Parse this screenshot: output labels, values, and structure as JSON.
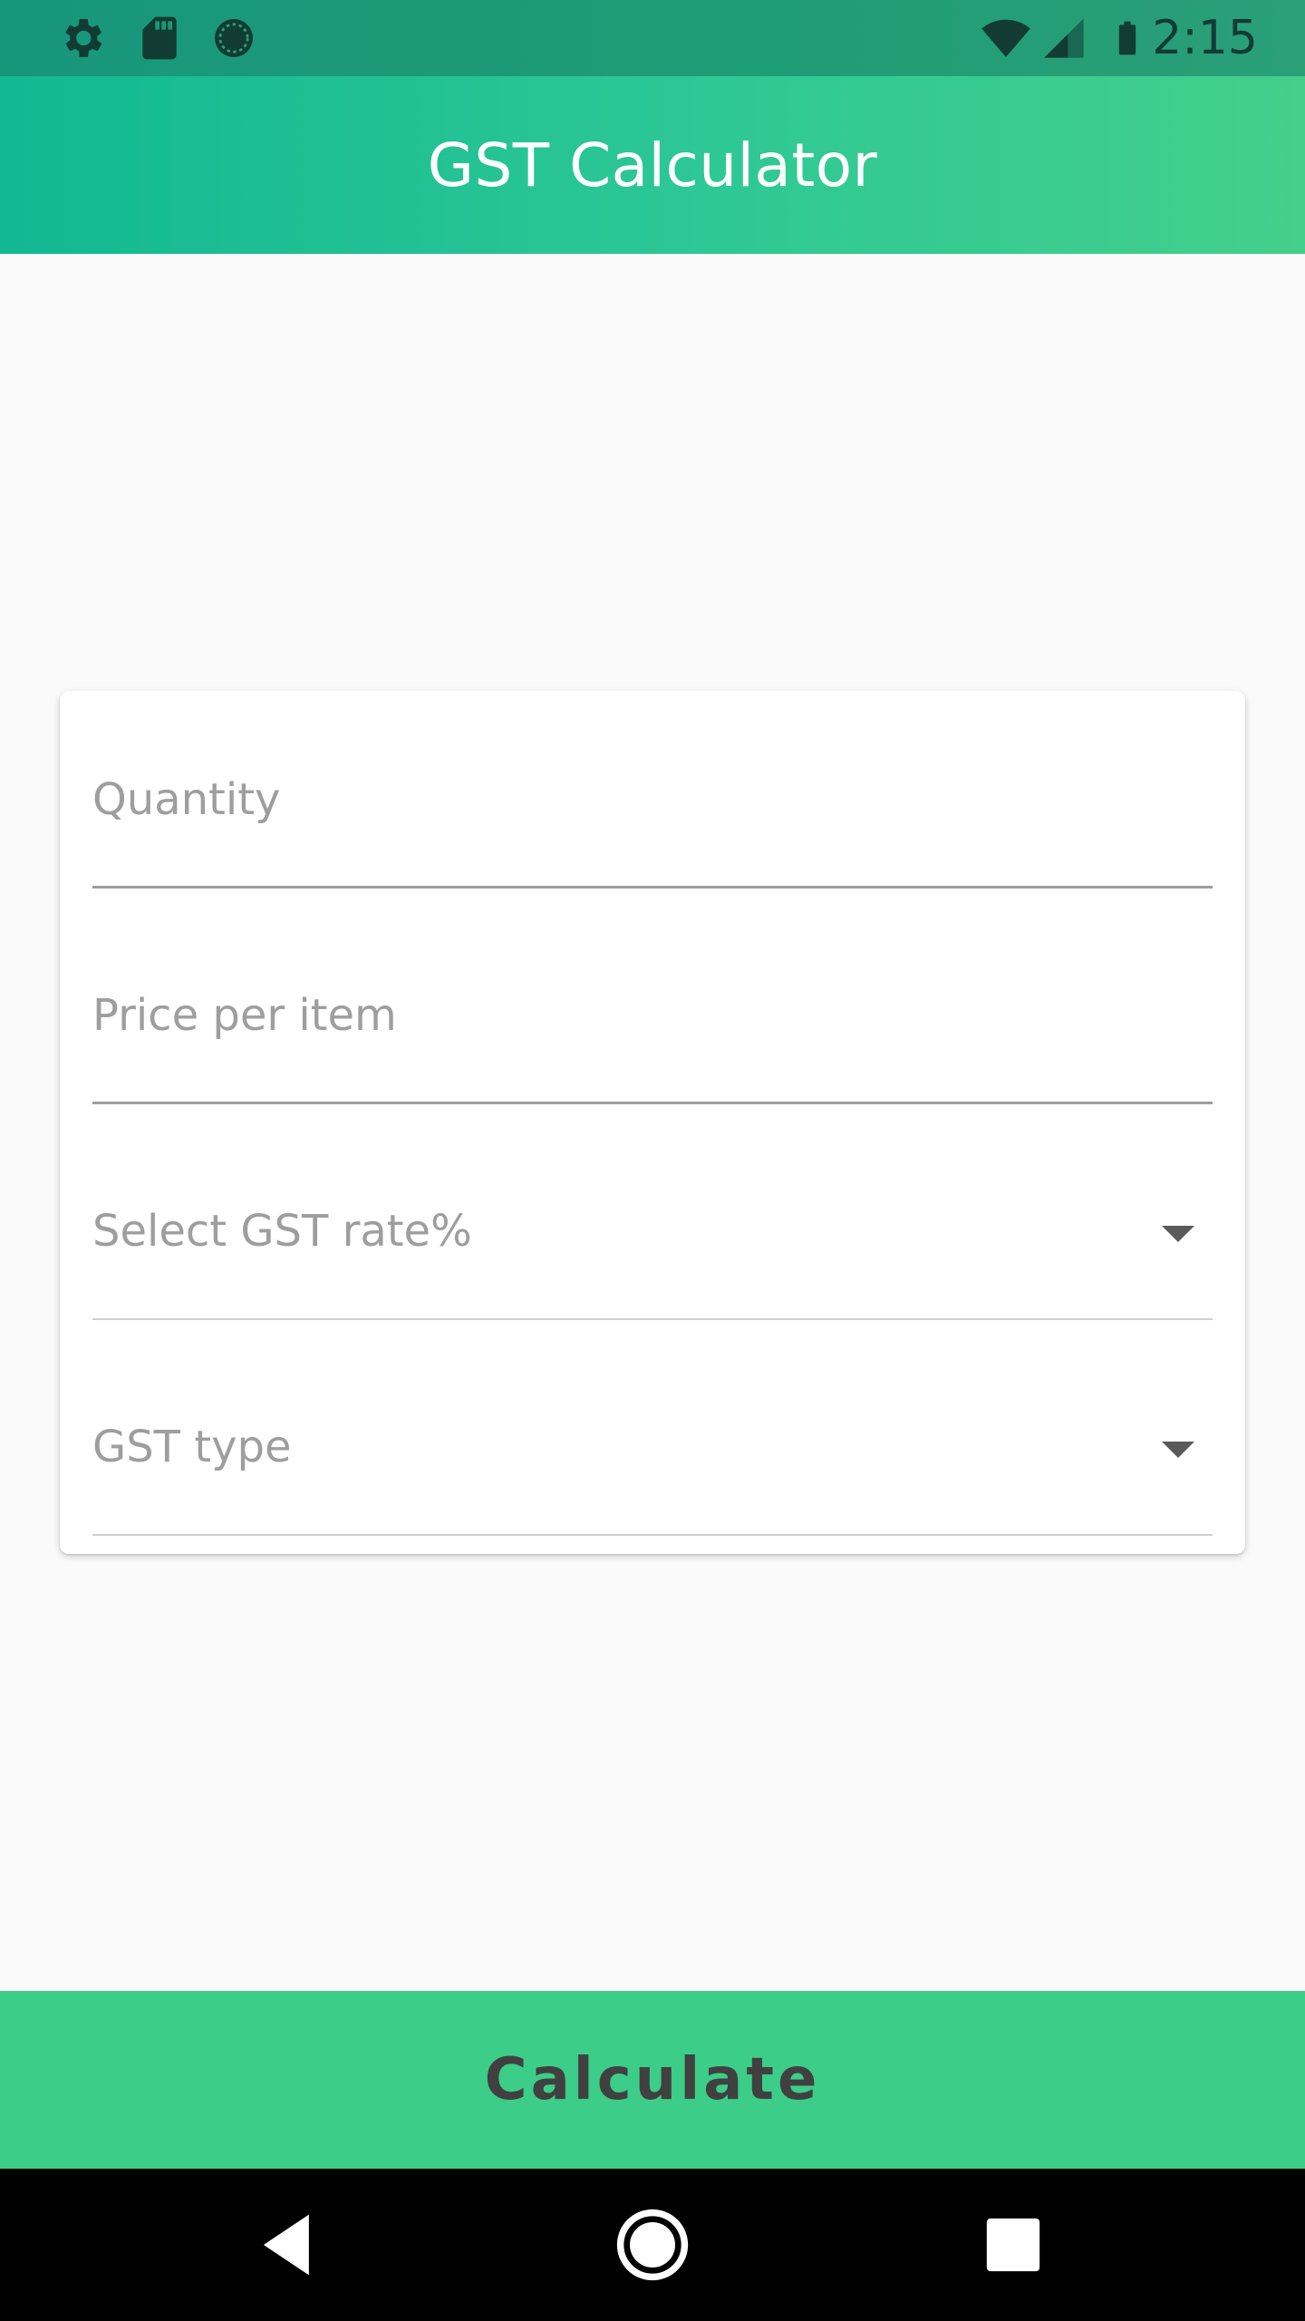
{
  "status_bar": {
    "time": "2:15",
    "left_icons": [
      "gear-icon",
      "sd-card-icon",
      "sync-icon"
    ],
    "right_icons": [
      "wifi-icon",
      "cell-signal-icon",
      "battery-icon"
    ]
  },
  "app_bar": {
    "title": "GST Calculator"
  },
  "form": {
    "quantity": {
      "label": "Quantity",
      "value": ""
    },
    "price": {
      "label": "Price per item",
      "value": ""
    },
    "gst_rate": {
      "label": "Select GST rate%",
      "value": ""
    },
    "gst_type": {
      "label": "GST type",
      "value": ""
    }
  },
  "actions": {
    "calculate_label": "Calculate"
  },
  "nav_bar": {
    "buttons": [
      "back-icon",
      "home-icon",
      "recents-icon"
    ]
  },
  "colors": {
    "app_bar_start": "#12b892",
    "app_bar_end": "#44cf8b",
    "button": "#3ccd89",
    "hint_text": "#9e9e9e"
  }
}
